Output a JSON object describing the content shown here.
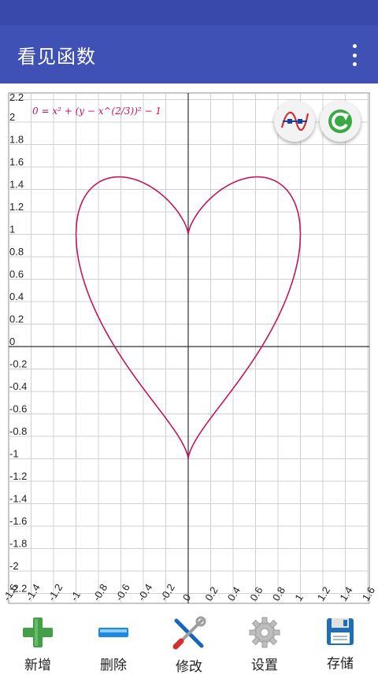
{
  "app": {
    "title": "看见函数"
  },
  "formula": "0 = x² + (y − x^(2/3))² − 1",
  "toolbar": [
    {
      "label": "新增",
      "icon": "add-icon"
    },
    {
      "label": "删除",
      "icon": "minus-icon"
    },
    {
      "label": "修改",
      "icon": "tools-icon"
    },
    {
      "label": "设置",
      "icon": "gear-icon"
    },
    {
      "label": "存储",
      "icon": "floppy-icon"
    }
  ],
  "colors": {
    "statusbar": "#3949ab",
    "appbar": "#3f51b5",
    "curve": "#c2185b",
    "grid": "#d0d0d0",
    "axis": "#303030",
    "formula": "#c2185b"
  },
  "chart_data": {
    "type": "line",
    "title": "",
    "xlabel": "",
    "ylabel": "",
    "xlim": [
      -1.6,
      1.6
    ],
    "ylim": [
      -2.2,
      2.2
    ],
    "xstep": 0.2,
    "ystep": 0.2,
    "grid": true,
    "x_tick_labels": [
      "-1.6",
      "-1.4",
      "-1.2",
      "-1",
      "-0.8",
      "-0.6",
      "-0.4",
      "-0.2",
      "0",
      "0.2",
      "0.4",
      "0.6",
      "0.8",
      "1",
      "1.2",
      "1.4",
      "1.6"
    ],
    "y_tick_labels": [
      "2.2",
      "2",
      "1.8",
      "1.6",
      "1.4",
      "1.2",
      "1",
      "0.8",
      "0.6",
      "0.4",
      "0.2",
      "0",
      "-0.2",
      "-0.4",
      "-0.6",
      "-0.8",
      "-1",
      "-1.2",
      "-1.4",
      "-1.6",
      "-1.8",
      "-2",
      "-2.2"
    ],
    "series": [
      {
        "equation": "x^2 + (y - x^(2/3))^2 = 1"
      }
    ]
  }
}
